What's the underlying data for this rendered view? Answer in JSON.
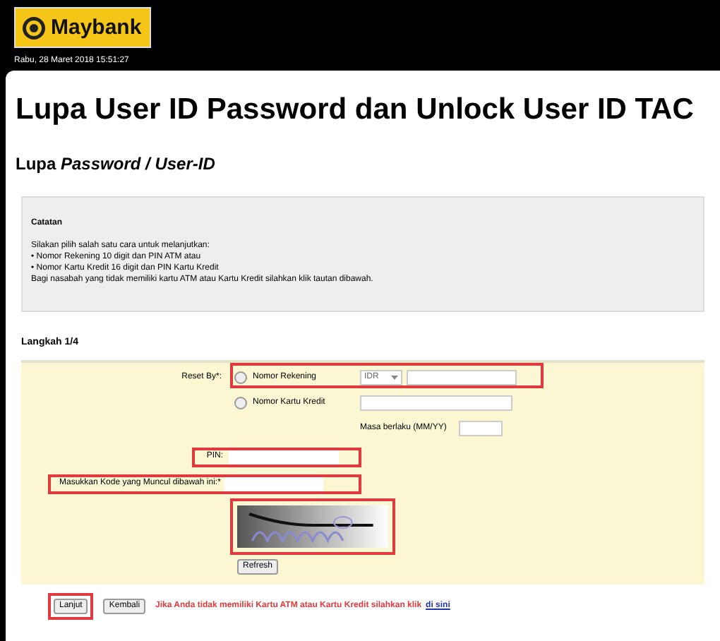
{
  "header": {
    "logo_text": "Maybank",
    "date": "Rabu, 28 Maret 2018 15:51:27"
  },
  "title": "Lupa User ID Password dan Unlock User ID TAC",
  "subtitle": "Lupa *Password / User-ID*",
  "note": {
    "title": "Catatan",
    "lines": [
      "Silakan pilih salah satu cara untuk melanjutkan:",
      "• Nomor Rekening 10 digit dan PIN ATM atau",
      "• Nomor Kartu Kredit 16 digit dan PIN Kartu Kredit",
      "Bagi nasabah yang tidak memiliki kartu ATM atau Kartu Kredit silahkan klik tautan dibawah."
    ]
  },
  "step": "Langkah 1/4",
  "form": {
    "reset_label": "Reset By*:",
    "options": [
      {
        "label": "Nomor Rekening",
        "selected": false,
        "currency": "IDR",
        "highlighted": true
      },
      {
        "label": "Nomor Kartu Kredit",
        "selected": false,
        "highlighted": false
      }
    ],
    "expiry_label": "Masa berlaku (MM/YY)",
    "pin": {
      "label": "PIN:",
      "highlighted": true
    },
    "code": {
      "label": "Masukkan Kode yang Muncul dibawah ini:*",
      "highlighted": true
    },
    "captcha": {
      "kind": "picture",
      "highlighted": true
    },
    "refresh": "Refresh"
  },
  "actions": [
    {
      "label": "Lanjut",
      "highlighted": true
    },
    {
      "label": "Kembali",
      "highlighted": false
    }
  ],
  "footer": {
    "text": "Jika Anda tidak memiliki Kartu ATM atau Kartu Kredit silahkan klik",
    "link": "di sini"
  }
}
